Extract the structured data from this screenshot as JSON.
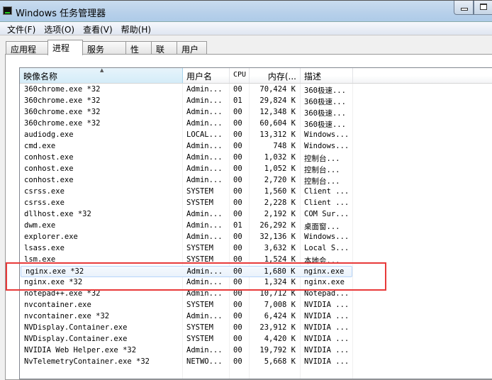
{
  "window": {
    "title": "Windows 任务管理器"
  },
  "menu": [
    "文件(F)",
    "选项(O)",
    "查看(V)",
    "帮助(H)"
  ],
  "tabs": [
    "应用程序",
    "进程",
    "服务",
    "性能",
    "联网",
    "用户"
  ],
  "active_tab": 1,
  "columns": [
    "映像名称",
    "用户名",
    "CPU",
    "内存(...",
    "描述"
  ],
  "rows": [
    [
      "360chrome.exe *32",
      "Admin...",
      "00",
      "70,424 K",
      "360极速..."
    ],
    [
      "360chrome.exe *32",
      "Admin...",
      "01",
      "29,824 K",
      "360极速..."
    ],
    [
      "360chrome.exe *32",
      "Admin...",
      "00",
      "12,348 K",
      "360极速..."
    ],
    [
      "360chrome.exe *32",
      "Admin...",
      "00",
      "60,604 K",
      "360极速..."
    ],
    [
      "audiodg.exe",
      "LOCAL...",
      "00",
      "13,312 K",
      "Windows..."
    ],
    [
      "cmd.exe",
      "Admin...",
      "00",
      "748 K",
      "Windows..."
    ],
    [
      "conhost.exe",
      "Admin...",
      "00",
      "1,032 K",
      "控制台..."
    ],
    [
      "conhost.exe",
      "Admin...",
      "00",
      "1,052 K",
      "控制台..."
    ],
    [
      "conhost.exe",
      "Admin...",
      "00",
      "2,720 K",
      "控制台..."
    ],
    [
      "csrss.exe",
      "SYSTEM",
      "00",
      "1,560 K",
      "Client ..."
    ],
    [
      "csrss.exe",
      "SYSTEM",
      "00",
      "2,228 K",
      "Client ..."
    ],
    [
      "dllhost.exe *32",
      "Admin...",
      "00",
      "2,192 K",
      "COM Sur..."
    ],
    [
      "dwm.exe",
      "Admin...",
      "01",
      "26,292 K",
      "桌面窗..."
    ],
    [
      "explorer.exe",
      "Admin...",
      "00",
      "32,136 K",
      "Windows..."
    ],
    [
      "lsass.exe",
      "SYSTEM",
      "00",
      "3,632 K",
      "Local S..."
    ],
    [
      "lsm.exe",
      "SYSTEM",
      "00",
      "1,524 K",
      "本地会..."
    ],
    [
      "nginx.exe *32",
      "Admin...",
      "00",
      "1,680 K",
      "nginx.exe"
    ],
    [
      "nginx.exe *32",
      "Admin...",
      "00",
      "1,324 K",
      "nginx.exe"
    ],
    [
      "notepad++.exe *32",
      "Admin...",
      "00",
      "10,712 K",
      "Notepad..."
    ],
    [
      "nvcontainer.exe",
      "SYSTEM",
      "00",
      "7,008 K",
      "NVIDIA ..."
    ],
    [
      "nvcontainer.exe *32",
      "Admin...",
      "00",
      "6,424 K",
      "NVIDIA ..."
    ],
    [
      "NVDisplay.Container.exe",
      "SYSTEM",
      "00",
      "23,912 K",
      "NVIDIA ..."
    ],
    [
      "NVDisplay.Container.exe",
      "SYSTEM",
      "00",
      "4,420 K",
      "NVIDIA ..."
    ],
    [
      "NVIDIA Web Helper.exe *32",
      "Admin...",
      "00",
      "19,792 K",
      "NVIDIA ..."
    ],
    [
      "NvTelemetryContainer.exe *32",
      "NETWO...",
      "00",
      "5,668 K",
      "NVIDIA ..."
    ]
  ],
  "selected_row": 16,
  "highlight_color": "#e83a3a"
}
